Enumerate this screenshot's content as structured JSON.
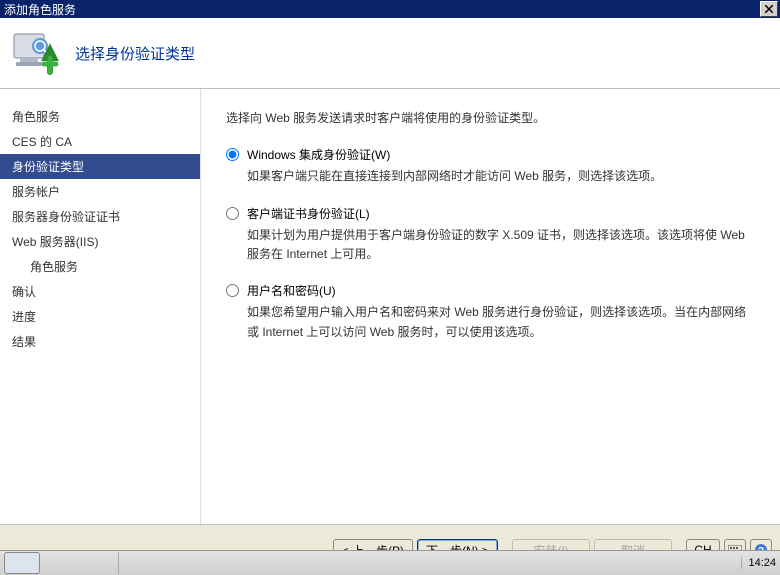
{
  "titlebar": {
    "title": "添加角色服务"
  },
  "header": {
    "title": "选择身份验证类型"
  },
  "sidebar": {
    "items": [
      {
        "label": "角色服务",
        "selected": false,
        "indent": false
      },
      {
        "label": "CES 的 CA",
        "selected": false,
        "indent": false
      },
      {
        "label": "身份验证类型",
        "selected": true,
        "indent": false
      },
      {
        "label": "服务帐户",
        "selected": false,
        "indent": false
      },
      {
        "label": "服务器身份验证证书",
        "selected": false,
        "indent": false
      },
      {
        "label": "Web 服务器(IIS)",
        "selected": false,
        "indent": false
      },
      {
        "label": "角色服务",
        "selected": false,
        "indent": true
      },
      {
        "label": "确认",
        "selected": false,
        "indent": false
      },
      {
        "label": "进度",
        "selected": false,
        "indent": false
      },
      {
        "label": "结果",
        "selected": false,
        "indent": false
      }
    ]
  },
  "content": {
    "prompt": "选择向 Web 服务发送请求时客户端将使用的身份验证类型。",
    "options": [
      {
        "label": "Windows 集成身份验证(W)",
        "desc": "如果客户端只能在直接连接到内部网络时才能访问 Web 服务，则选择该选项。",
        "checked": true
      },
      {
        "label": "客户端证书身份验证(L)",
        "desc": "如果计划为用户提供用于客户端身份验证的数字 X.509 证书，则选择该选项。该选项将使 Web 服务在 Internet 上可用。",
        "checked": false
      },
      {
        "label": "用户名和密码(U)",
        "desc": "如果您希望用户输入用户名和密码来对 Web 服务进行身份验证，则选择该选项。当在内部网络或 Internet 上可以访问 Web 服务时，可以使用该选项。",
        "checked": false
      }
    ]
  },
  "footer": {
    "prev": "< 上一步(P)",
    "next": "下一步(N) >",
    "install": "安装(I)",
    "cancel": "取消",
    "lang": "CH"
  },
  "taskbar": {
    "clock": "14:24"
  }
}
